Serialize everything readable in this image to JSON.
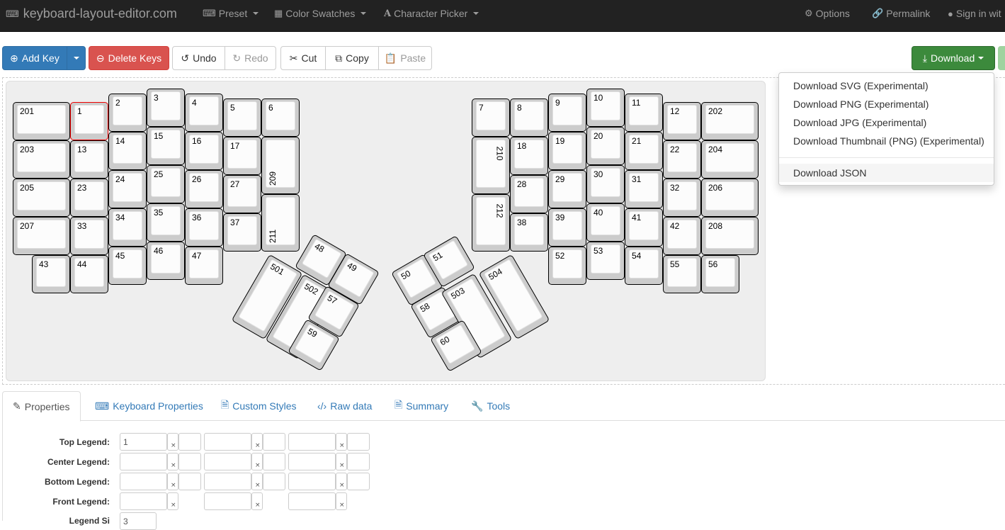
{
  "navbar": {
    "brand": "keyboard-layout-editor.com",
    "brand_icon": "keyboard-icon",
    "items": [
      {
        "label": "Preset",
        "icon": "keyboard-icon"
      },
      {
        "label": "Color Swatches",
        "icon": "grid-icon"
      },
      {
        "label": "Character Picker",
        "icon": "font-icon"
      }
    ],
    "right_items": [
      {
        "label": "Options",
        "icon": "gear-icon"
      },
      {
        "label": "Permalink",
        "icon": "link-icon"
      },
      {
        "label": "Sign in wit",
        "icon": "github-icon"
      }
    ]
  },
  "toolbar": {
    "add_key": "Add Key",
    "delete_keys": "Delete Keys",
    "undo": "Undo",
    "redo": "Redo",
    "cut": "Cut",
    "copy": "Copy",
    "paste": "Paste",
    "download": "Download"
  },
  "download_menu": {
    "items": [
      "Download SVG (Experimental)",
      "Download PNG (Experimental)",
      "Download JPG (Experimental)",
      "Download Thumbnail (PNG) (Experimental)"
    ],
    "json_item": "Download JSON"
  },
  "keyboard": {
    "selected_key": "1",
    "keys": [
      {
        "label": "201"
      },
      {
        "label": "1"
      },
      {
        "label": "2"
      },
      {
        "label": "3"
      },
      {
        "label": "4"
      },
      {
        "label": "5"
      },
      {
        "label": "6"
      },
      {
        "label": "203"
      },
      {
        "label": "13"
      },
      {
        "label": "14"
      },
      {
        "label": "15"
      },
      {
        "label": "16"
      },
      {
        "label": "17"
      },
      {
        "label": "209"
      },
      {
        "label": "205"
      },
      {
        "label": "23"
      },
      {
        "label": "24"
      },
      {
        "label": "25"
      },
      {
        "label": "26"
      },
      {
        "label": "27"
      },
      {
        "label": "211"
      },
      {
        "label": "207"
      },
      {
        "label": "33"
      },
      {
        "label": "34"
      },
      {
        "label": "35"
      },
      {
        "label": "36"
      },
      {
        "label": "37"
      },
      {
        "label": "43"
      },
      {
        "label": "44"
      },
      {
        "label": "45"
      },
      {
        "label": "46"
      },
      {
        "label": "47"
      },
      {
        "label": "7"
      },
      {
        "label": "8"
      },
      {
        "label": "9"
      },
      {
        "label": "10"
      },
      {
        "label": "11"
      },
      {
        "label": "12"
      },
      {
        "label": "202"
      },
      {
        "label": "210"
      },
      {
        "label": "18"
      },
      {
        "label": "19"
      },
      {
        "label": "20"
      },
      {
        "label": "21"
      },
      {
        "label": "22"
      },
      {
        "label": "204"
      },
      {
        "label": "28"
      },
      {
        "label": "29"
      },
      {
        "label": "30"
      },
      {
        "label": "31"
      },
      {
        "label": "32"
      },
      {
        "label": "206"
      },
      {
        "label": "212"
      },
      {
        "label": "38"
      },
      {
        "label": "39"
      },
      {
        "label": "40"
      },
      {
        "label": "41"
      },
      {
        "label": "42"
      },
      {
        "label": "208"
      },
      {
        "label": "52"
      },
      {
        "label": "53"
      },
      {
        "label": "54"
      },
      {
        "label": "55"
      },
      {
        "label": "56"
      },
      {
        "label": "501"
      },
      {
        "label": "502"
      },
      {
        "label": "48"
      },
      {
        "label": "49"
      },
      {
        "label": "57"
      },
      {
        "label": "59"
      },
      {
        "label": "50"
      },
      {
        "label": "51"
      },
      {
        "label": "58"
      },
      {
        "label": "503"
      },
      {
        "label": "504"
      },
      {
        "label": "60"
      }
    ]
  },
  "tabs": [
    {
      "label": "Properties",
      "icon": "edit-icon",
      "active": true
    },
    {
      "label": "Keyboard Properties",
      "icon": "keyboard-icon"
    },
    {
      "label": "Custom Styles",
      "icon": "file-icon"
    },
    {
      "label": "Raw data",
      "icon": "code-icon"
    },
    {
      "label": "Summary",
      "icon": "file-icon"
    },
    {
      "label": "Tools",
      "icon": "wrench-icon"
    }
  ],
  "properties": {
    "rows": [
      {
        "label": "Top Legend:",
        "values": [
          "1",
          "",
          ""
        ]
      },
      {
        "label": "Center Legend:",
        "values": [
          "",
          "",
          ""
        ]
      },
      {
        "label": "Bottom Legend:",
        "values": [
          "",
          "",
          ""
        ]
      },
      {
        "label": "Front Legend:",
        "values": [
          "",
          "",
          ""
        ]
      }
    ],
    "clear_glyph": "×",
    "legend_size_value": "3"
  }
}
